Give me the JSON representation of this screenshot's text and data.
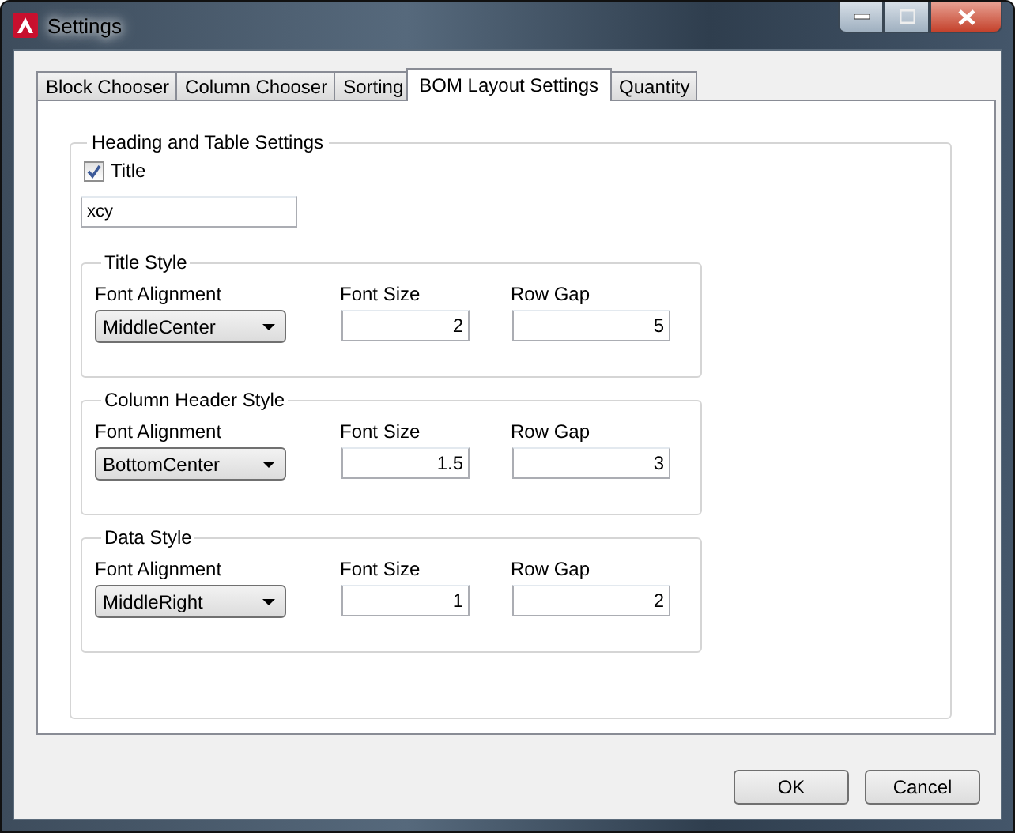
{
  "window": {
    "title": "Settings"
  },
  "tabs": [
    {
      "label": "Block Chooser",
      "selected": false
    },
    {
      "label": "Column Chooser",
      "selected": false
    },
    {
      "label": "Sorting",
      "selected": false
    },
    {
      "label": "BOM Layout Settings",
      "selected": true
    },
    {
      "label": "Quantity",
      "selected": false
    }
  ],
  "heading_group": {
    "title": "Heading and Table Settings",
    "title_checkbox": {
      "label": "Title",
      "checked": true
    },
    "title_text": {
      "value": "xcy"
    },
    "styles": [
      {
        "title": "Title Style",
        "alignment_label": "Font Alignment",
        "alignment": "MiddleCenter",
        "font_size_label": "Font Size",
        "font_size": "2",
        "row_gap_label": "Row Gap",
        "row_gap": "5"
      },
      {
        "title": "Column Header Style",
        "alignment_label": "Font Alignment",
        "alignment": "BottomCenter",
        "font_size_label": "Font Size",
        "font_size": "1.5",
        "row_gap_label": "Row Gap",
        "row_gap": "3"
      },
      {
        "title": "Data Style",
        "alignment_label": "Font Alignment",
        "alignment": "MiddleRight",
        "font_size_label": "Font Size",
        "font_size": "1",
        "row_gap_label": "Row Gap",
        "row_gap": "2"
      }
    ]
  },
  "buttons": [
    "OK",
    "Cancel"
  ]
}
